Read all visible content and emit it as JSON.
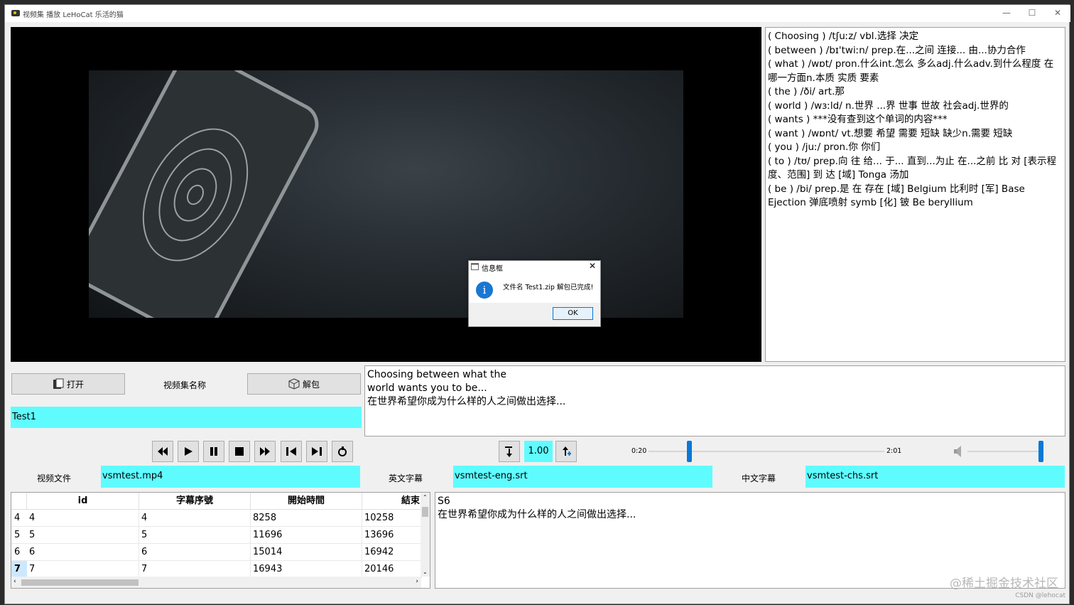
{
  "window": {
    "title": "视频集 播放  LeHoCat 乐活的猫",
    "minimize": "—",
    "maximize": "☐",
    "close": "✕"
  },
  "dictionary": {
    "lines": [
      "( Choosing ) /tʃuːz/  vbl.选择 决定",
      "( between ) /bɪ'twiːn/   prep.在...之间 连接... 由...协力合作",
      "( what ) /wɒt/   pron.什么int.怎么 多么adj.什么adv.到什么程度 在哪一方面n.本质 实质 要素",
      "( the ) /ði/   art.那",
      "( world ) /wɜːld/  n.世界 ...界 世事 世故 社会adj.世界的",
      "( wants )  ***没有查到这个单词的内容***",
      "( want ) /wɒnt/  vt.想要 希望 需要 短缺 缺少n.需要 短缺",
      "( you ) /juː/   pron.你 你们",
      "( to ) /tʊ/   prep.向 往 给... 于... 直到...为止 在...之前 比 对 [表示程度、范围] 到 达 [域] Tonga 汤加",
      "( be ) /bi/  prep.是 在 存在 [域] Belgium  比利时 [军] Base Ejection 弹底喷射 symb [化] 铍 Be beryllium"
    ]
  },
  "controls": {
    "open_label": "打开",
    "collection_name_label": "视频集名称",
    "unpack_label": "解包",
    "collection_value": "Test1"
  },
  "subtitle_panel": {
    "english": "Choosing between what the\nworld wants you to be...",
    "chinese": "在世界希望你成为什么样的人之间做出选择..."
  },
  "playback": {
    "speed": "1.00",
    "time_start": "0:20",
    "time_end": "2:01"
  },
  "files": {
    "video_label": "视频文件",
    "video_value": "vsmtest.mp4",
    "eng_label": "英文字幕",
    "eng_value": "vsmtest-eng.srt",
    "chs_label": "中文字幕",
    "chs_value": "vsmtest-chs.srt"
  },
  "table": {
    "headers": [
      "id",
      "字幕序號",
      "開始時間",
      "結束"
    ],
    "rows": [
      {
        "row": "4",
        "cells": [
          "4",
          "4",
          "8258",
          "10258"
        ]
      },
      {
        "row": "5",
        "cells": [
          "5",
          "5",
          "11696",
          "13696"
        ]
      },
      {
        "row": "6",
        "cells": [
          "6",
          "6",
          "15014",
          "16942"
        ]
      },
      {
        "row": "7",
        "cells": [
          "7",
          "7",
          "16943",
          "20146"
        ]
      }
    ]
  },
  "detail": {
    "index": "S6",
    "text": "在世界希望你成为什么样的人之间做出选择..."
  },
  "dialog": {
    "title": "信息框",
    "close": "✕",
    "icon": "i",
    "message": "文件名 Test1.zip 解包已完成!",
    "ok_label": "OK"
  },
  "watermark": {
    "main": "@稀土掘金技术社区",
    "small": "CSDN @lehocat"
  }
}
